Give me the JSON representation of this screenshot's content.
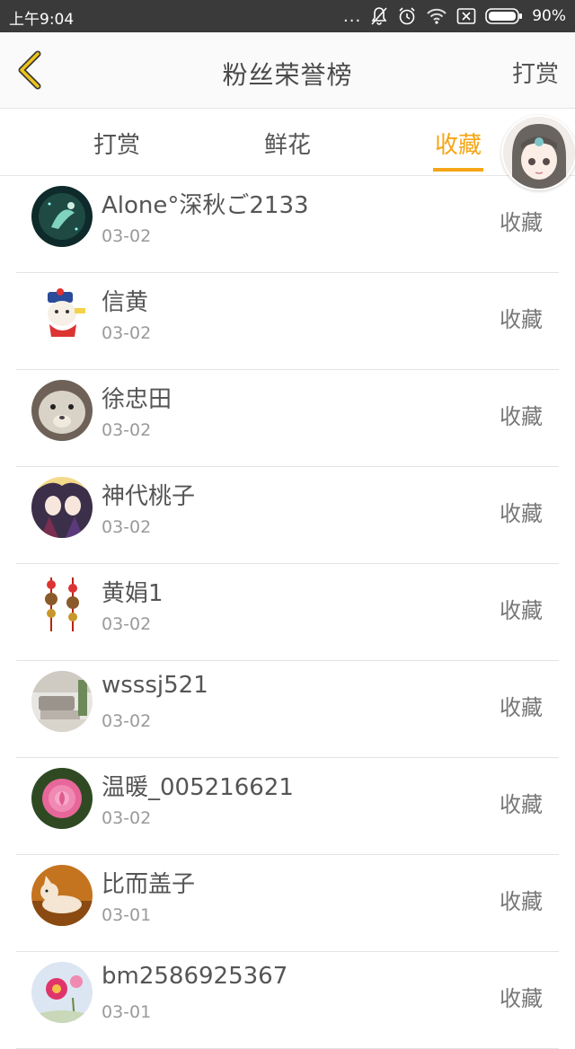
{
  "status_bar": {
    "time": "上午9:04",
    "dots": "...",
    "battery": "90%"
  },
  "header": {
    "title": "粉丝荣誉榜",
    "action": "打赏",
    "accent_color": "#f5a516"
  },
  "tabs": [
    {
      "label": "打赏",
      "active": false
    },
    {
      "label": "鲜花",
      "active": false
    },
    {
      "label": "收藏",
      "active": true
    }
  ],
  "list": [
    {
      "name": "Alone°深秋ご2133",
      "date": "03-02",
      "type": "收藏"
    },
    {
      "name": "信黄",
      "date": "03-02",
      "type": "收藏"
    },
    {
      "name": "徐忠田",
      "date": "03-02",
      "type": "收藏"
    },
    {
      "name": "神代桃子",
      "date": "03-02",
      "type": "收藏"
    },
    {
      "name": "黄娟1",
      "date": "03-02",
      "type": "收藏"
    },
    {
      "name": "wsssj521",
      "date": "03-02",
      "type": "收藏"
    },
    {
      "name": "温暖_005216621",
      "date": "03-02",
      "type": "收藏"
    },
    {
      "name": "比而盖子",
      "date": "03-01",
      "type": "收藏"
    },
    {
      "name": "bm2586925367",
      "date": "03-01",
      "type": "收藏"
    }
  ]
}
